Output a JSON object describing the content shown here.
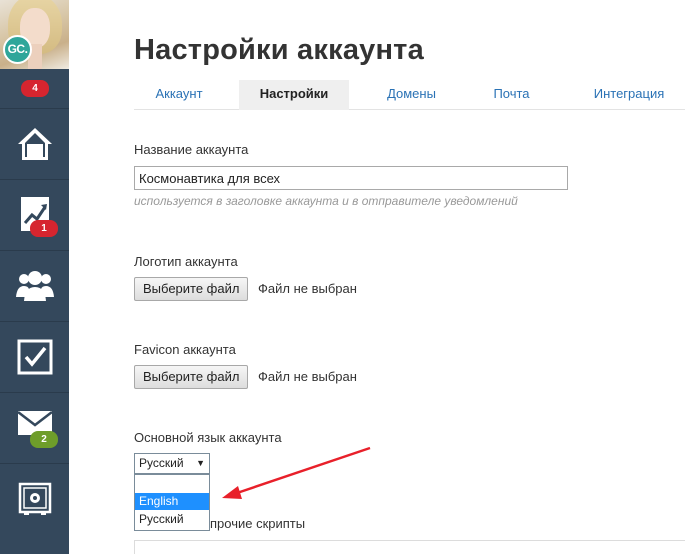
{
  "sidebar": {
    "avatar_initials": "GC.",
    "notifications_badge": "4",
    "items": [
      {
        "name": "home",
        "icon": "home-icon",
        "badge": ""
      },
      {
        "name": "deals",
        "icon": "chart-icon",
        "badge": "1",
        "badge_color": "#d6252f"
      },
      {
        "name": "contacts",
        "icon": "users-icon",
        "badge": ""
      },
      {
        "name": "tasks",
        "icon": "checkbox-icon",
        "badge": ""
      },
      {
        "name": "mail",
        "icon": "envelope-icon",
        "badge": "2",
        "badge_color": "#6e9d2a"
      },
      {
        "name": "settings",
        "icon": "safe-gear-icon",
        "badge": ""
      }
    ],
    "bg_color": "#34485c"
  },
  "page": {
    "title": "Настройки аккаунта"
  },
  "tabs": [
    {
      "label": "Аккаунт",
      "active": false
    },
    {
      "label": "Настройки",
      "active": true
    },
    {
      "label": "Домены",
      "active": false
    },
    {
      "label": "Почта",
      "active": false
    },
    {
      "label": "Интеграция",
      "active": false
    }
  ],
  "form": {
    "account_name": {
      "label": "Название аккаунта",
      "value": "Космонавтика для всех",
      "hint": "используется в заголовке аккаунта и в отправителе уведомлений"
    },
    "logo": {
      "label": "Логотип аккаунта",
      "button": "Выберите файл",
      "status": "Файл не выбран"
    },
    "favicon": {
      "label": "Favicon аккаунта",
      "button": "Выберите файл",
      "status": "Файл не выбран"
    },
    "language": {
      "label": "Основной язык аккаунта",
      "selected": "Русский",
      "options": [
        "",
        "English",
        "Русский"
      ],
      "highlighted": "English"
    },
    "scripts_label_partial": "прочие скрипты"
  },
  "colors": {
    "link": "#2a72b5",
    "annotation_arrow": "#e8202a",
    "highlight": "#1e90ff"
  }
}
